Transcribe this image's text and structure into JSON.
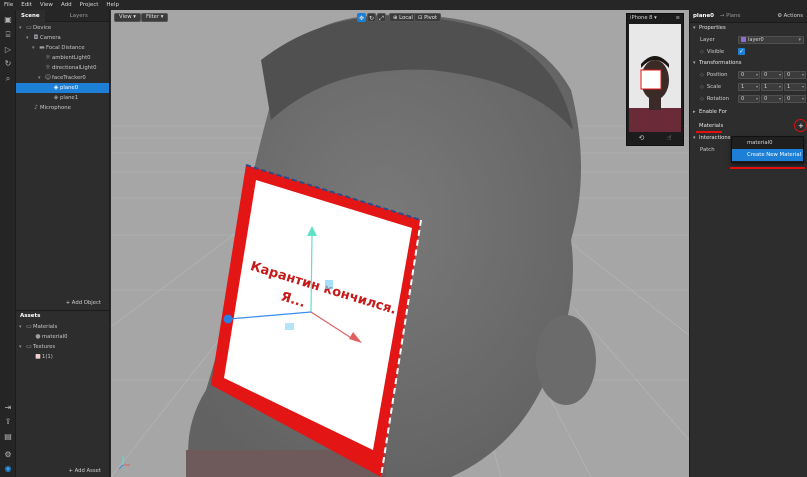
{
  "menu": [
    "File",
    "Edit",
    "View",
    "Add",
    "Project",
    "Help"
  ],
  "scene": {
    "tabs": [
      "Scene",
      "Layers"
    ],
    "tree": [
      {
        "label": "Device",
        "depth": 0,
        "icon": "device-icon",
        "expanded": true
      },
      {
        "label": "Camera",
        "depth": 1,
        "icon": "camera-icon",
        "expanded": true
      },
      {
        "label": "Focal Distance",
        "depth": 2,
        "icon": "focal-distance-icon",
        "expanded": true
      },
      {
        "label": "ambientLight0",
        "depth": 3,
        "icon": "light-icon"
      },
      {
        "label": "directionalLight0",
        "depth": 3,
        "icon": "light-icon"
      },
      {
        "label": "faceTracker0",
        "depth": 3,
        "icon": "face-tracker-icon",
        "expanded": true
      },
      {
        "label": "plane0",
        "depth": 4,
        "icon": "plane-icon",
        "selected": true
      },
      {
        "label": "plane1",
        "depth": 4,
        "icon": "plane-icon"
      },
      {
        "label": "Microphone",
        "depth": 1,
        "icon": "microphone-icon"
      }
    ],
    "add_object": "+ Add Object"
  },
  "assets": {
    "title": "Assets",
    "tree": [
      {
        "label": "Materials",
        "depth": 0,
        "icon": "folder-icon",
        "expanded": true
      },
      {
        "label": "material0",
        "depth": 1,
        "icon": "material-icon"
      },
      {
        "label": "Textures",
        "depth": 0,
        "icon": "folder-icon",
        "expanded": true
      },
      {
        "label": "1(1)",
        "depth": 1,
        "icon": "texture-icon"
      }
    ],
    "add_asset": "+ Add Asset"
  },
  "viewport": {
    "view_label": "View",
    "filter_label": "Filter",
    "local_label": "Local",
    "pivot_label": "Pivot",
    "plane_text_line1": "Карантин кончился.",
    "plane_text_line2": "Я..."
  },
  "preview": {
    "device": "iPhone 8",
    "menu_icon": "≡"
  },
  "inspector": {
    "name": "plane0",
    "type": "→ Plane",
    "actions": "Actions",
    "properties_label": "Properties",
    "layer_label": "Layer",
    "layer_value": "layer0",
    "visible_label": "Visible",
    "transformations_label": "Transformations",
    "position_label": "Position",
    "position": [
      "0",
      "0",
      "0"
    ],
    "scale_label": "Scale",
    "scale": [
      "1",
      "1",
      "1"
    ],
    "rotation_label": "Rotation",
    "rotation": [
      "0",
      "0",
      "0"
    ],
    "enable_for_label": "Enable For",
    "materials_label": "Materials",
    "interactions_label": "Interactions",
    "patch_label": "Patch",
    "add_material": "+"
  },
  "dropdown": {
    "items": [
      "material0",
      "Create New Material"
    ]
  },
  "colors": {
    "accent": "#1e7fd6",
    "annotation_red": "#e01010"
  }
}
